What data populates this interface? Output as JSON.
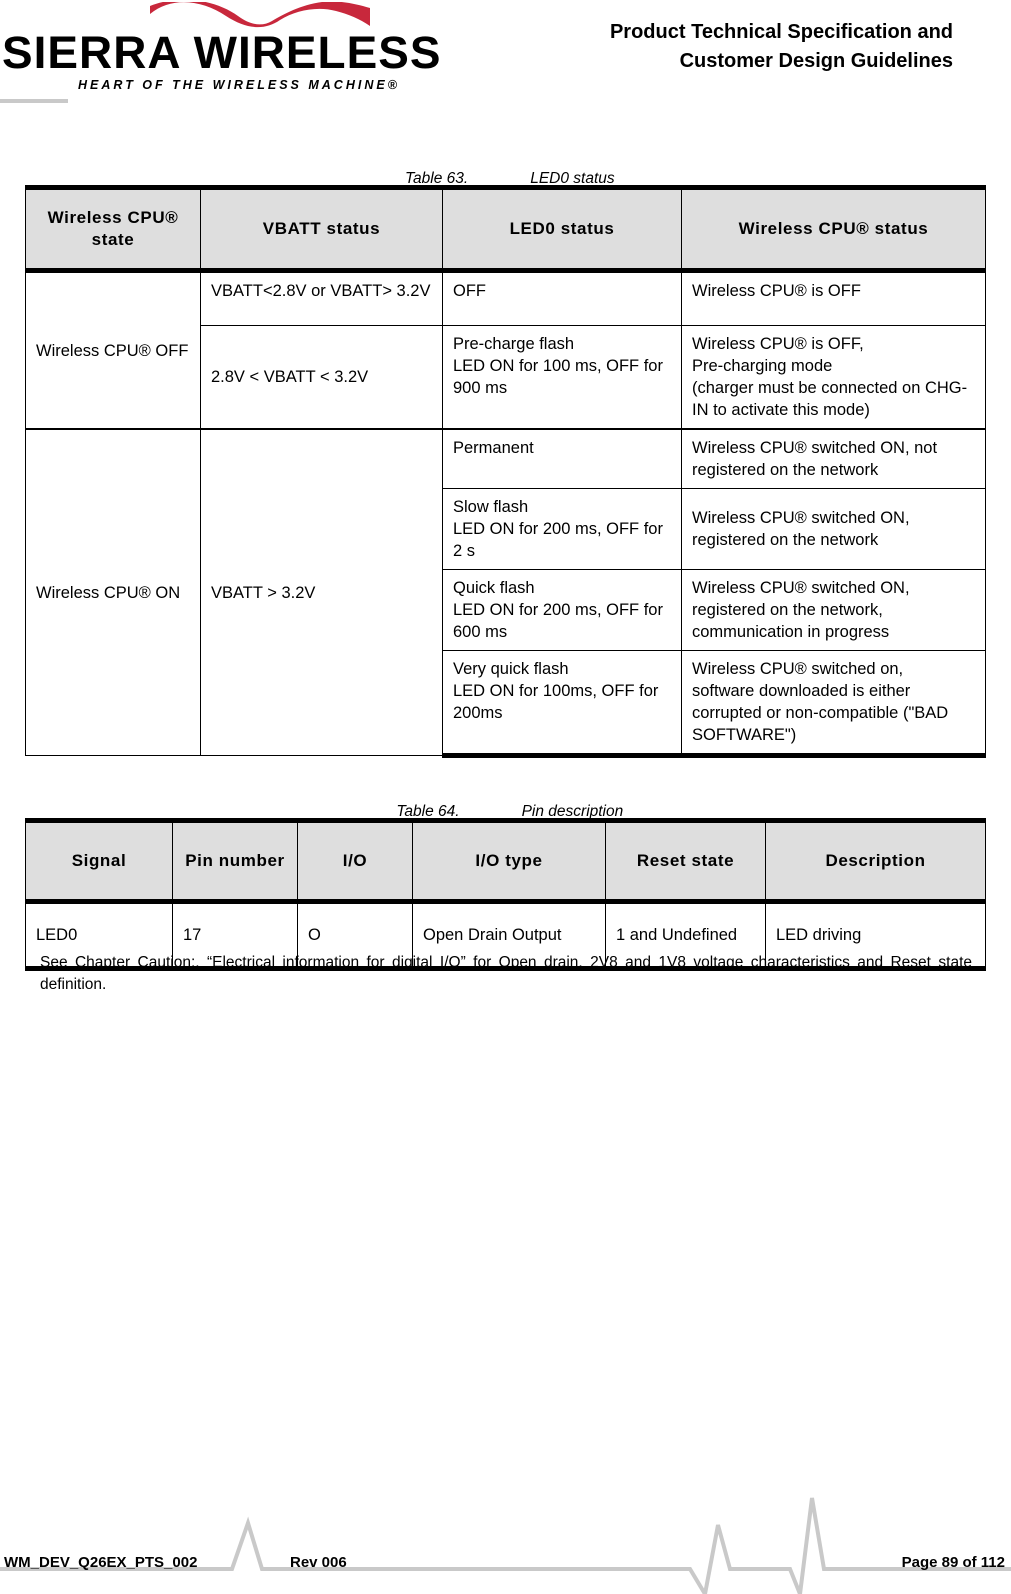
{
  "header": {
    "logo": {
      "wordmark": "SIERRA WIRELESS",
      "tagline": "HEART OF THE WIRELESS MACHINE®",
      "swoosh_color": "#C8283C"
    },
    "title_line1": "Product Technical Specification and",
    "title_line2": "Customer Design Guidelines"
  },
  "table63": {
    "caption_number": "Table 63.",
    "caption_title": "LED0 status",
    "headers": [
      "Wireless CPU® state",
      "VBATT status",
      "LED0 status",
      "Wireless CPU® status"
    ],
    "rows": [
      {
        "state": "Wireless CPU® OFF",
        "vbatt": "VBATT<2.8V or VBATT> 3.2V",
        "led0": "OFF",
        "cpu_status": "Wireless CPU® is OFF"
      },
      {
        "state": "",
        "vbatt": "2.8V < VBATT < 3.2V",
        "led0_line1": "Pre-charge flash",
        "led0_line2": "LED ON for 100 ms, OFF for 900 ms",
        "cpu_line1": "Wireless CPU® is OFF,",
        "cpu_line2": "Pre-charging mode",
        "cpu_line3": "(charger must be connected on CHG-IN to activate this mode)"
      },
      {
        "state": "Wireless CPU® ON",
        "vbatt": "VBATT > 3.2V",
        "led0": "Permanent",
        "cpu_status": "Wireless CPU® switched ON, not registered on the network"
      },
      {
        "led0_line1": "Slow flash",
        "led0_line2": "LED ON for 200 ms, OFF for 2 s",
        "cpu_status": "Wireless CPU® switched ON, registered on the network"
      },
      {
        "led0_line1": "Quick flash",
        "led0_line2": "LED ON for 200 ms, OFF for 600 ms",
        "cpu_status": "Wireless CPU® switched ON, registered on the network, communication in progress"
      },
      {
        "led0_line1": "Very quick flash",
        "led0_line2": "LED ON for 100ms, OFF for 200ms",
        "cpu_line1": "Wireless CPU® switched on,",
        "cpu_line2": "software downloaded is either corrupted or non-compatible (\"BAD SOFTWARE\")"
      }
    ]
  },
  "table64": {
    "caption_number": "Table 64.",
    "caption_title": "Pin description",
    "headers": [
      "Signal",
      "Pin number",
      "I/O",
      "I/O type",
      "Reset state",
      "Description"
    ],
    "rows": [
      {
        "signal": "LED0",
        "pin_number": "17",
        "io": "O",
        "io_type": "Open Drain Output",
        "reset_state": "1 and Undefined",
        "description": "LED driving"
      }
    ]
  },
  "note": "See Chapter Caution:, “Electrical information for digital I/O” for Open drain, 2V8 and 1V8 voltage characteristics and Reset state definition.",
  "footer": {
    "doc_id": "WM_DEV_Q26EX_PTS_002",
    "revision": "Rev 006",
    "page": "Page 89 of 112"
  }
}
